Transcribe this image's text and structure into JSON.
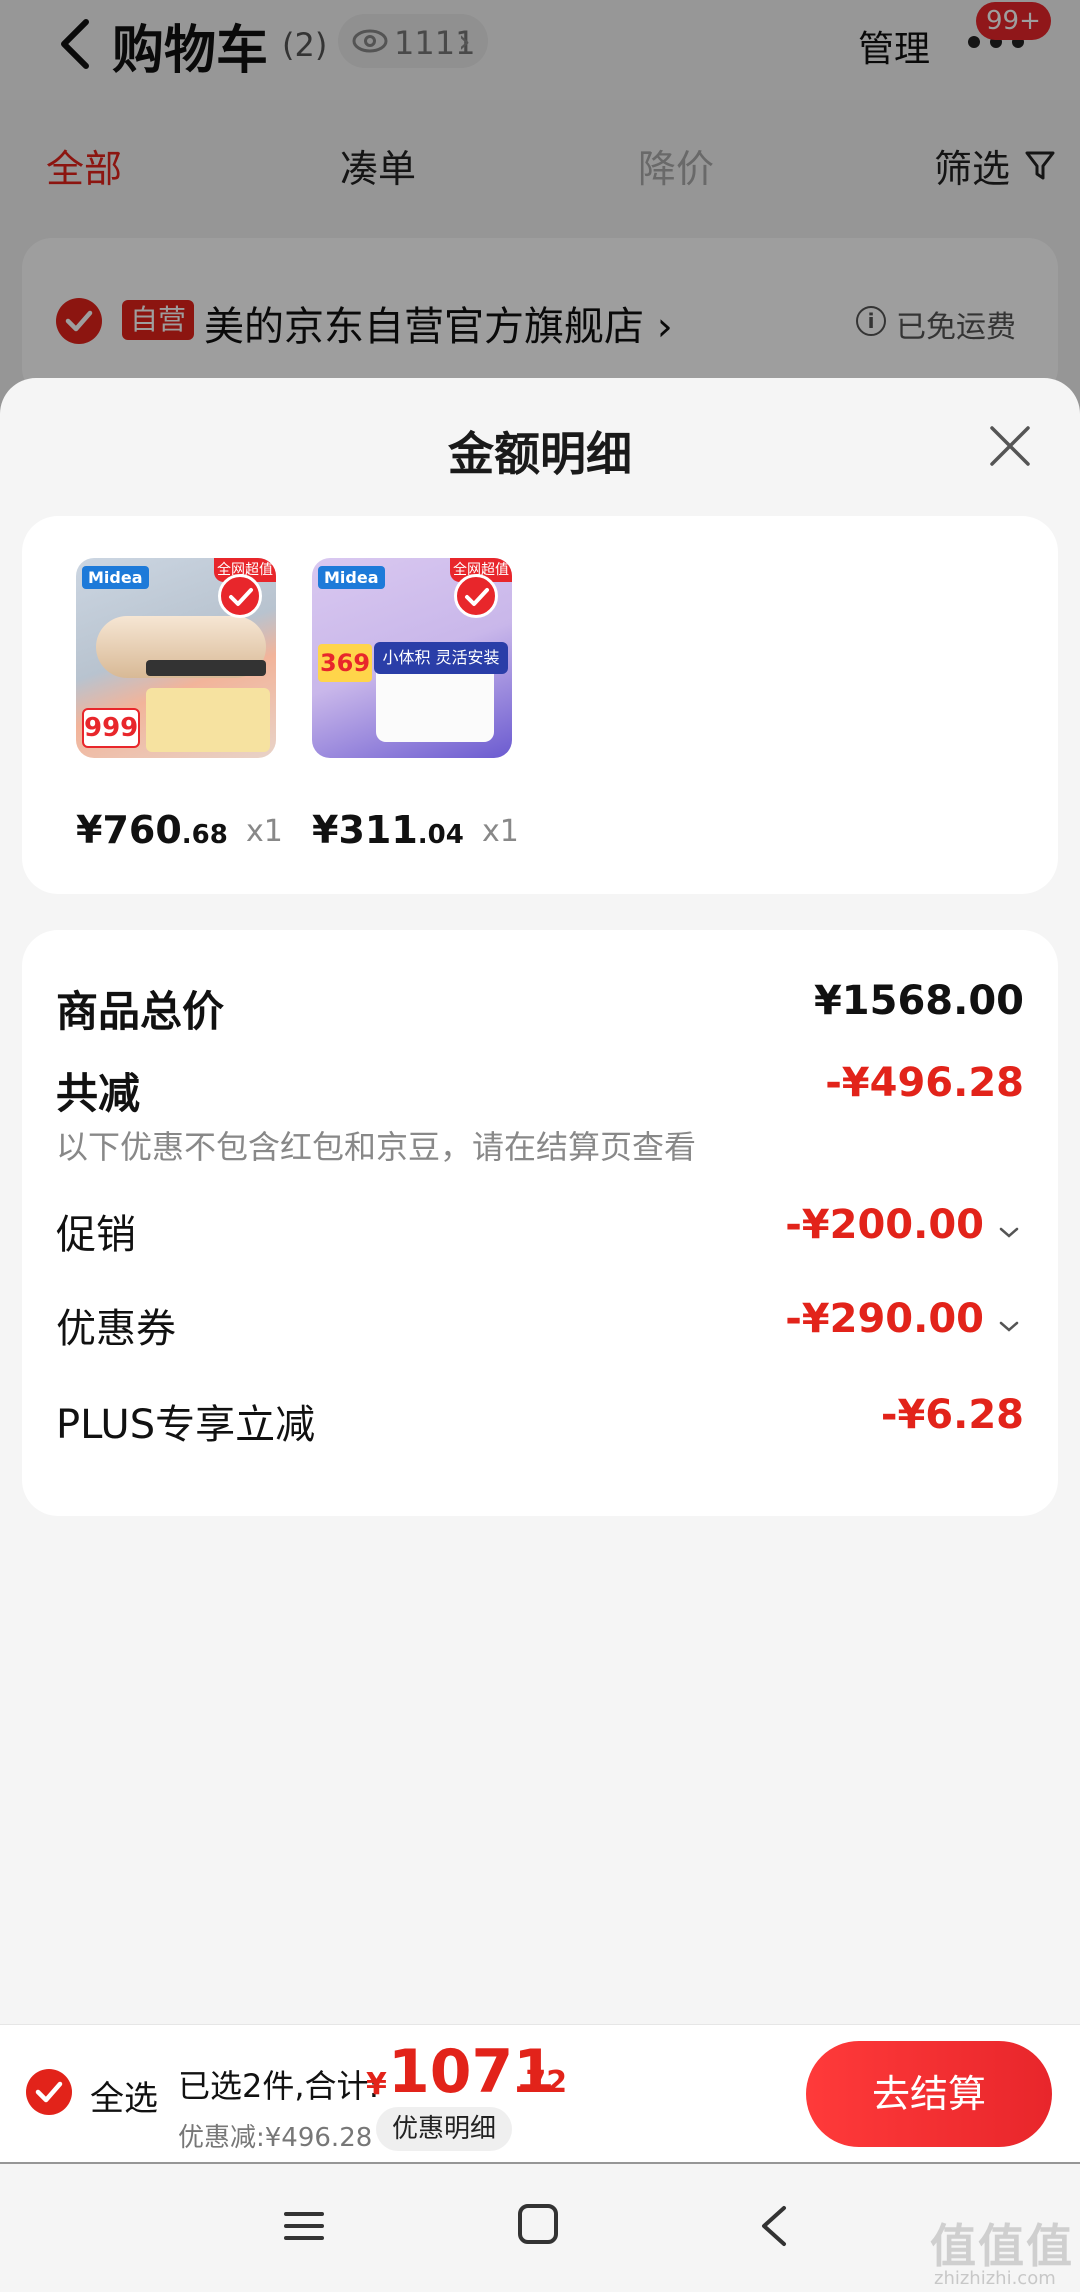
{
  "header": {
    "title": "购物车",
    "count": "(2)",
    "views": "1111",
    "manage": "管理",
    "badge": "99+"
  },
  "tabs": {
    "all": "全部",
    "combine": "凑单",
    "price_drop": "降价",
    "filter": "筛选"
  },
  "store": {
    "tag": "自营",
    "name": "美的京东自营官方旗舰店",
    "chevron": "›",
    "shipping": "已免运费"
  },
  "sheet": {
    "title": "金额明细",
    "items": [
      {
        "price_int": "¥760",
        "price_dec": ".68",
        "qty": "x1",
        "art_text": "999",
        "corner": "全网超值"
      },
      {
        "price_int": "¥311",
        "price_dec": ".04",
        "qty": "x1",
        "art_text": "369",
        "corner": "全网超值",
        "banner": "小体积 灵活安装"
      }
    ],
    "brand": "Midea",
    "summary": {
      "total_label": "商品总价",
      "total_value": "¥1568.00",
      "discount_label": "共减",
      "discount_value": "-¥496.28",
      "note": "以下优惠不包含红包和京豆，请在结算页查看",
      "promo_label": "促销",
      "promo_value": "-¥200.00",
      "coupon_label": "优惠券",
      "coupon_value": "-¥290.00",
      "plus_label": "PLUS专享立减",
      "plus_value": "-¥6.28"
    }
  },
  "footer": {
    "select_all": "全选",
    "selected": "已选2件,合计:",
    "currency": "¥",
    "total_int": "1071",
    "total_dec": ".72",
    "discount": "优惠减:¥496.28",
    "detail": "优惠明细",
    "checkout": "去结算"
  },
  "watermark": {
    "text": "值值值",
    "sub": "zhizhizhi.com"
  },
  "colors": {
    "accent": "#e2231a",
    "sheet_bg": "#f5f5f5"
  }
}
